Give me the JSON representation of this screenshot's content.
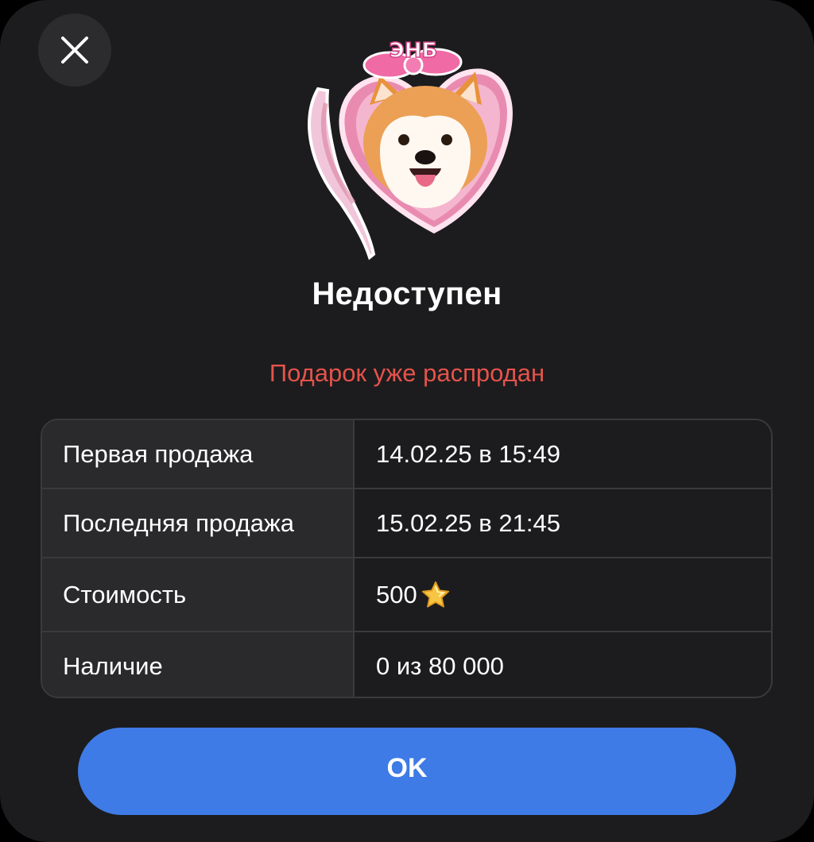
{
  "header": {
    "close_icon": "close-icon"
  },
  "gift": {
    "sticker_icon": "shiba-heart-sticker",
    "sticker_lettering": "ЭНБ",
    "title": "Недоступен",
    "status": "Подарок уже распродан"
  },
  "details": {
    "rows": [
      {
        "label": "Первая продажа",
        "value": "14.02.25 в 15:49"
      },
      {
        "label": "Последняя продажа",
        "value": "15.02.25 в 21:45"
      },
      {
        "label": "Стоимость",
        "value": "500",
        "icon": "star-icon"
      },
      {
        "label": "Наличие",
        "value": "0 из 80 000"
      }
    ]
  },
  "footer": {
    "ok_label": "OK"
  },
  "colors": {
    "background": "#1c1c1e",
    "accent": "#3e7be6",
    "status_red": "#e5534b",
    "table_border": "#3a3a3c"
  }
}
